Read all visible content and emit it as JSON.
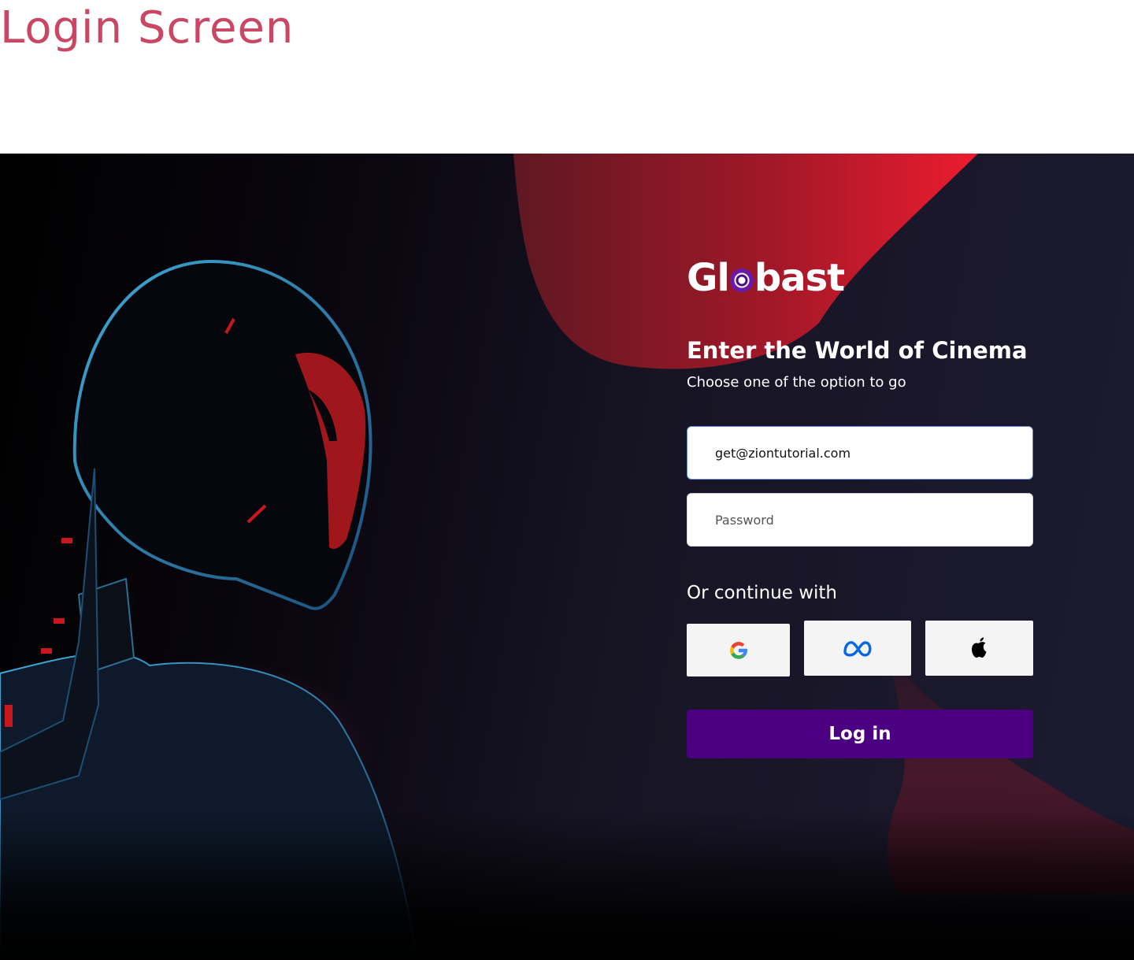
{
  "page": {
    "heading": "Login Screen",
    "heading_color": "#c94763"
  },
  "brand": {
    "logo_before": "Gl",
    "logo_after": "bast",
    "accent_color": "#e8192c",
    "primary_color": "#4b0082"
  },
  "hero": {
    "title": "Enter the World of Cinema",
    "subtitle": "Choose one of the option to go"
  },
  "form": {
    "email_value": "get@ziontutorial.com",
    "password_placeholder": "Password"
  },
  "social": {
    "label": "Or continue with",
    "buttons": [
      {
        "icon": "google-icon"
      },
      {
        "icon": "meta-icon"
      },
      {
        "icon": "apple-icon"
      }
    ]
  },
  "actions": {
    "login_label": "Log in"
  }
}
